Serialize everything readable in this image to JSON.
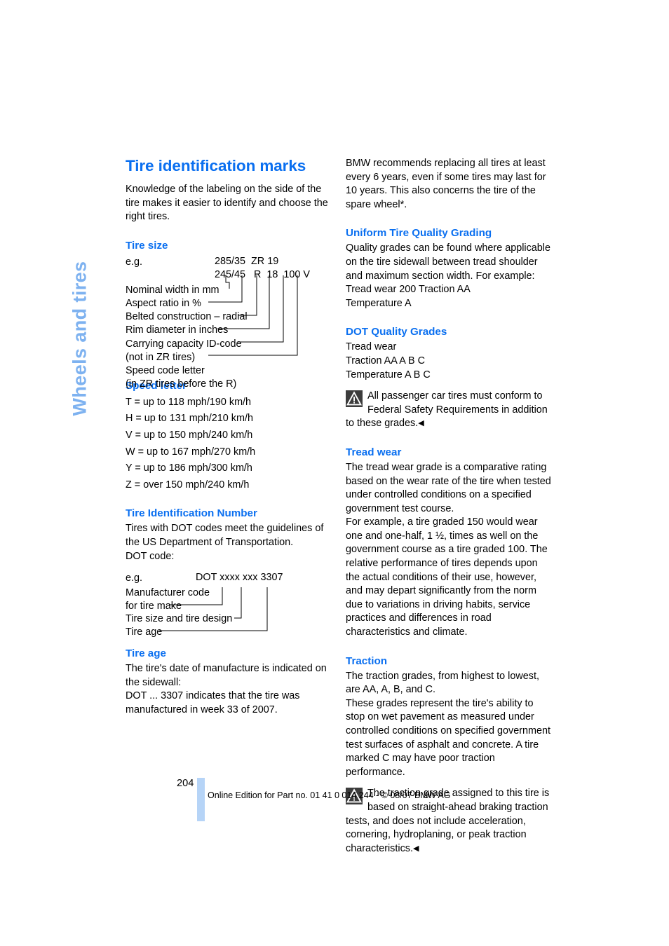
{
  "chapter_tab": "Wheels and tires",
  "page_number": "204",
  "footer": "Online Edition for Part no. 01 41 0 014 244 - © 08/07 BMW AG",
  "left_column": {
    "title": "Tire identification marks",
    "intro": "Knowledge of the labeling on the side of the tire makes it easier to identify and choose the right tires.",
    "tire_size": {
      "heading": "Tire size",
      "eg_label": "e.g.",
      "code_line_1": "285/35  ZR 19",
      "code_line_2": "245/45   R  18  100 V",
      "labels": [
        "Nominal width in mm",
        "Aspect ratio in %",
        "Belted construction – radial",
        "Rim diameter in inches",
        "Carrying capacity ID-code",
        "(not in ZR tires)",
        "Speed code letter",
        "(in ZR tires before the R)"
      ]
    },
    "speed_letter": {
      "heading": "Speed letter",
      "rows": [
        "T = up to 118 mph/190 km/h",
        "H = up to 131 mph/210 km/h",
        "V = up to 150 mph/240 km/h",
        "W = up to 167 mph/270 km/h",
        "Y = up to 186 mph/300 km/h",
        "Z = over 150 mph/240 km/h"
      ]
    },
    "tin": {
      "heading": "Tire Identification Number",
      "body": "Tires with DOT codes meet the guidelines of the US Department of Transportation.",
      "dot_code_label": "DOT code:",
      "eg_label": "e.g.",
      "code": "DOT xxxx xxx 3307",
      "labels": [
        "Manufacturer code",
        "for tire make",
        "Tire size and tire design",
        "Tire age"
      ]
    },
    "tire_age": {
      "heading": "Tire age",
      "body_1": "The tire's date of manufacture is indicated on the sidewall:",
      "body_2": "DOT ... 3307 indicates that the tire was manufactured in week 33 of 2007."
    }
  },
  "right_column": {
    "intro": "BMW recommends replacing all tires at least every 6 years, even if some tires may last for 10 years. This also concerns the tire of the spare wheel*.",
    "utqg": {
      "heading": "Uniform Tire Quality Grading",
      "body": "Quality grades can be found where applicable on the tire sidewall between tread shoulder and maximum section width. For example:",
      "example_1": "Tread wear 200 Traction AA",
      "example_2": "Temperature A"
    },
    "dot_quality": {
      "heading": "DOT Quality Grades",
      "rows": [
        "Tread wear",
        "Traction AA A B C",
        "Temperature A B C"
      ],
      "warning": "All passenger car tires must conform to Federal Safety Requirements in addition to these grades.",
      "warning_end": "◀"
    },
    "tread_wear": {
      "heading": "Tread wear",
      "body_1": "The tread wear grade is a comparative rating based on the wear rate of the tire when tested under controlled conditions on a specified government test course.",
      "body_2": "For example, a tire graded 150 would wear one and one-half, 1 ½, times as well on the government course as a tire graded 100. The relative performance of tires depends upon the actual conditions of their use, however, and may depart significantly from the norm due to variations in driving habits, service practices and differences in road characteristics and climate."
    },
    "traction": {
      "heading": "Traction",
      "body_1": "The traction grades, from highest to lowest, are AA, A, B, and C.",
      "body_2": "These grades represent the tire's ability to stop on wet pavement as measured under controlled conditions on specified government test surfaces of asphalt and concrete. A tire marked C may have poor traction performance.",
      "warning": "The traction grade assigned to this tire is based on straight-ahead braking traction tests, and does not include acceleration, cornering, hydroplaning, or peak traction characteristics.",
      "warning_end": "◀"
    }
  },
  "colors": {
    "heading_blue": "#0a6ff0",
    "tab_blue": "#7eb2f0",
    "bar_blue": "#b6d4f7",
    "warn_icon_bg": "#3c3c3c"
  }
}
